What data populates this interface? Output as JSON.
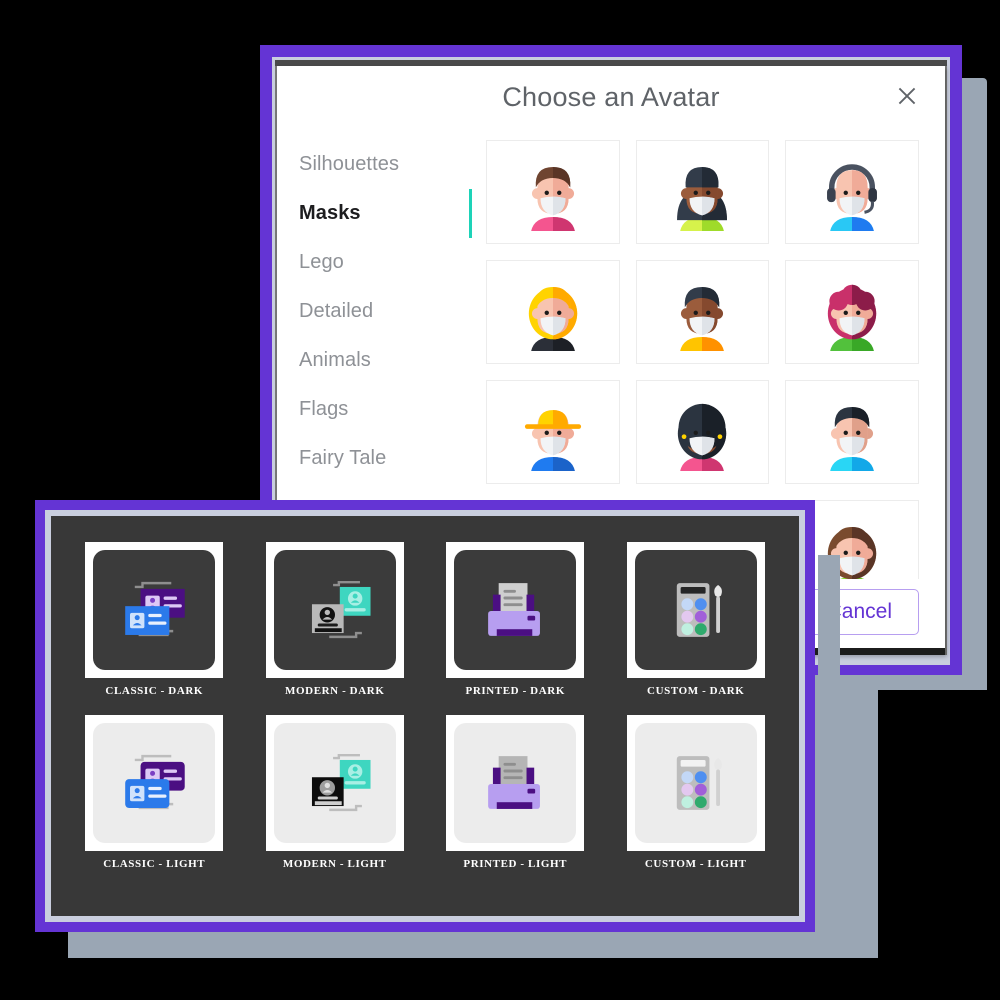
{
  "colors": {
    "accent_purple": "#6434d4",
    "frame_light": "#c9cede",
    "backdrop_gray": "#9aa6b4",
    "panel_dark": "#383838",
    "active_teal": "#1dd3b8",
    "title_gray": "#5f6368"
  },
  "avatar_dialog": {
    "title": "Choose an Avatar",
    "close_icon": "close-icon",
    "categories": [
      {
        "label": "Silhouettes",
        "active": false
      },
      {
        "label": "Masks",
        "active": true
      },
      {
        "label": "Lego",
        "active": false
      },
      {
        "label": "Detailed",
        "active": false
      },
      {
        "label": "Animals",
        "active": false
      },
      {
        "label": "Flags",
        "active": false
      },
      {
        "label": "Fairy Tale",
        "active": false
      }
    ],
    "avatars": [
      {
        "name": "avatar-brown-hair-pink-shirt",
        "hair": "#6f4430",
        "hair2": "#5a3526",
        "skin": "#f8c4b0",
        "skin2": "#f0ab98",
        "shirt": "#f4558f",
        "shirt2": "#cf3670",
        "style": "short"
      },
      {
        "name": "avatar-beanie-dark-coat",
        "hair": "#323c4a",
        "hair2": "#232b36",
        "skin": "#9b5c3c",
        "skin2": "#85492e",
        "shirt": "#d6f24b",
        "shirt2": "#9fdb2a",
        "style": "hood"
      },
      {
        "name": "avatar-headset-blue-shirt",
        "hair": "#f8c4b0",
        "hair2": "#f0ab98",
        "skin": "#f8c4b0",
        "skin2": "#f0ab98",
        "shirt": "#29c8f5",
        "shirt2": "#1f7bf0",
        "style": "headset"
      },
      {
        "name": "avatar-blonde-long-hair",
        "hair": "#ffd300",
        "hair2": "#ffaa00",
        "skin": "#f8c4b0",
        "skin2": "#f0ab98",
        "shirt": "#2b2f38",
        "shirt2": "#1d2026",
        "style": "long"
      },
      {
        "name": "avatar-dark-hair-yellow-shirt",
        "hair": "#323c4a",
        "hair2": "#232b36",
        "skin": "#9b5c3c",
        "skin2": "#85492e",
        "shirt": "#ffc400",
        "shirt2": "#ff9100",
        "style": "short"
      },
      {
        "name": "avatar-magenta-curly-green-shirt",
        "hair": "#c9306a",
        "hair2": "#8c1c49",
        "skin": "#f8c4b0",
        "skin2": "#f0ab98",
        "shirt": "#52c13c",
        "shirt2": "#39a827",
        "style": "curly"
      },
      {
        "name": "avatar-yellow-hat-overalls",
        "hair": "#ffd300",
        "hair2": "#ffaa00",
        "skin": "#f8c4b0",
        "skin2": "#f0ab98",
        "shirt": "#1f7bf0",
        "shirt2": "#1b63c9",
        "style": "hat"
      },
      {
        "name": "avatar-afro-pink-shirt",
        "hair": "#2b3440",
        "hair2": "#1a2028",
        "skin": "#9b5c3c",
        "skin2": "#85492e",
        "shirt": "#f4558f",
        "shirt2": "#cf3670",
        "style": "afro"
      },
      {
        "name": "avatar-dark-hair-cyan-shirt",
        "hair": "#2b3440",
        "hair2": "#1a2028",
        "skin": "#f8c4b0",
        "skin2": "#e0a08a",
        "shirt": "#29d6f5",
        "shirt2": "#12a8e8",
        "style": "short"
      },
      {
        "name": "avatar-partial-row-left",
        "hair": "#6f4430",
        "hair2": "#5a3526",
        "skin": "#f8c4b0",
        "skin2": "#f0ab98",
        "shirt": "#52c13c",
        "shirt2": "#39a827",
        "style": "long"
      },
      {
        "name": "avatar-partial-row-mid",
        "hair": "#323c4a",
        "hair2": "#232b36",
        "skin": "#9b5c3c",
        "skin2": "#85492e",
        "shirt": "#ffc400",
        "shirt2": "#ff9100",
        "style": "short"
      },
      {
        "name": "avatar-brown-long-hair-green-shirt",
        "hair": "#7a4b2e",
        "hair2": "#5a3526",
        "skin": "#f8c4b0",
        "skin2": "#f0ab98",
        "shirt": "#8ee633",
        "shirt2": "#6dc21f",
        "style": "long"
      }
    ],
    "cancel_label": "Cancel"
  },
  "theme_picker": {
    "themes": [
      {
        "label": "CLASSIC - DARK",
        "icon": "classic-cards-icon",
        "mode": "dark"
      },
      {
        "label": "MODERN - DARK",
        "icon": "modern-cards-icon",
        "mode": "dark"
      },
      {
        "label": "PRINTED - DARK",
        "icon": "printer-icon",
        "mode": "dark"
      },
      {
        "label": "CUSTOM - DARK",
        "icon": "paint-palette-icon",
        "mode": "dark"
      },
      {
        "label": "CLASSIC - LIGHT",
        "icon": "classic-cards-icon",
        "mode": "light"
      },
      {
        "label": "MODERN - LIGHT",
        "icon": "modern-cards-icon",
        "mode": "light"
      },
      {
        "label": "PRINTED - LIGHT",
        "icon": "printer-icon",
        "mode": "light"
      },
      {
        "label": "CUSTOM - LIGHT",
        "icon": "paint-palette-icon",
        "mode": "light"
      }
    ]
  }
}
